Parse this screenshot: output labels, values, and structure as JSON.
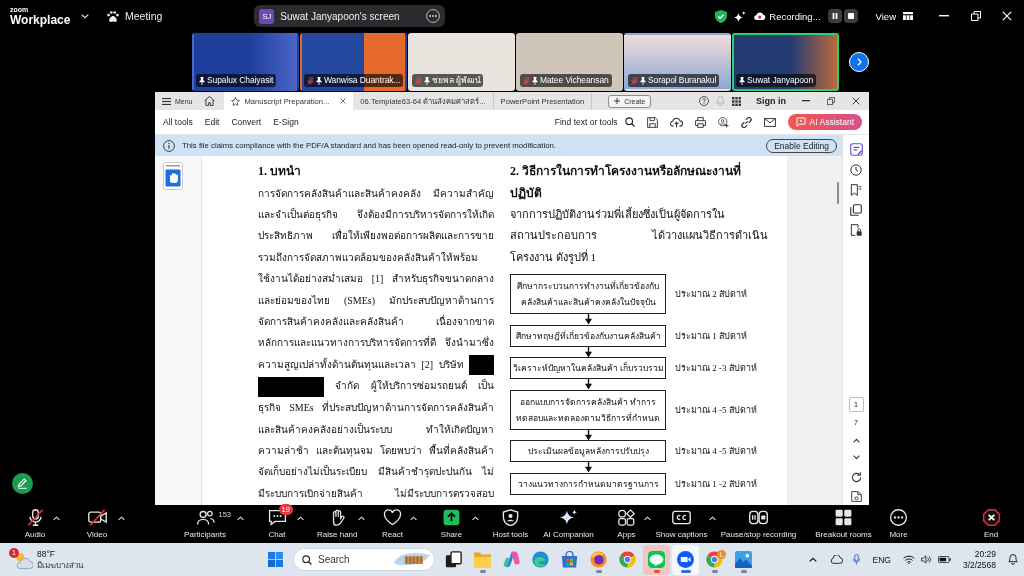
{
  "zoom_top_bar": {
    "logo": {
      "brand": "zoom",
      "product": "Workplace"
    },
    "meeting_label": "Meeting",
    "shared_screen": {
      "initials": "SJ",
      "title": "Suwat Janyapoon's screen"
    },
    "recording_label": "Recording...",
    "view_label": "View"
  },
  "video_strip": {
    "tiles": [
      {
        "name": "Supalux Chaiyasit",
        "muted": false,
        "speaking": false
      },
      {
        "name": "Wanwisa Duantrak...",
        "muted": true,
        "speaking": false
      },
      {
        "name": "ชยพล ผู้พัฒน์",
        "muted": true,
        "speaking": false
      },
      {
        "name": "Matee Vicheansan",
        "muted": true,
        "speaking": false
      },
      {
        "name": "Sorapol Buranakul",
        "muted": true,
        "speaking": false
      },
      {
        "name": "Suwat Janyapoon",
        "muted": false,
        "speaking": true
      }
    ]
  },
  "shared_window": {
    "tab_bar": {
      "menu_label": "Menu",
      "tabs": [
        {
          "label": "Manuscript Preparation...",
          "selected": true
        },
        {
          "label": "06.Template63-64 ด้านสังคมศาสตร์...",
          "selected": false
        },
        {
          "label": "PowerPoint Presentation",
          "selected": false
        }
      ],
      "create_label": "Create",
      "sign_in_label": "Sign in"
    },
    "toolbar": {
      "tools": [
        "All tools",
        "Edit",
        "Convert",
        "E-Sign"
      ],
      "find_label": "Find text or tools",
      "ai_label": "AI Assistant"
    },
    "banner": {
      "message": "This file claims compliance with the PDF/A standard and has been opened read-only to prevent modification.",
      "button_label": "Enable Editing"
    },
    "document": {
      "left_column": {
        "heading": "1. บทนำ",
        "lines": [
          {
            "kind": "text",
            "text": "การจัดการคลังสินค้าและสินค้าคงคลัง มีความสำคัญ"
          },
          {
            "kind": "text",
            "text": "และจำเป็นต่อธุรกิจ จึงต้องมีการบริหารจัดการให้เกิด"
          },
          {
            "kind": "text",
            "text": "ประสิทธิภาพ เพื่อให้เพียงพอต่อการผลิตและการขาย"
          },
          {
            "kind": "text",
            "text": "รวมถึงการจัดสภาพแวดล้อมของคลังสินค้าให้พร้อม"
          },
          {
            "kind": "text",
            "text": "ใช้งานได้อย่างสม่ำเสมอ [1] สำหรับธุรกิจขนาดกลาง"
          },
          {
            "kind": "text",
            "text": "และย่อมของไทย (SMEs) มักประสบปัญหาด้านการ"
          },
          {
            "kind": "text",
            "text": "จัดการสินค้าคงคลังและคลังสินค้า เนื่องจากขาด"
          },
          {
            "kind": "text",
            "text": "หลักการและแนวทางการบริหารจัดการที่ดี จึงนำมาซึ่ง"
          },
          {
            "kind": "redacted-end",
            "text": "ความสูญเปล่าทั้งด้านต้นทุนและเวลา [2] บริษัท"
          },
          {
            "kind": "redacted-start",
            "text": "จำกัด ผู้ให้บริการซ่อมรถยนต์ เป็น"
          },
          {
            "kind": "text",
            "text": "ธุรกิจ SMEs ที่ประสบปัญหาด้านการจัดการคลังสินค้า"
          },
          {
            "kind": "text",
            "text": "และสินค้าคงคลังอย่างเป็นระบบ ทำให้เกิดปัญหา"
          },
          {
            "kind": "text",
            "text": "ความล่าช้า และต้นทุนจม โดยพบว่า พื้นที่คลังสินค้า"
          },
          {
            "kind": "text",
            "text": "จัดเก็บอย่างไม่เป็นระเบียบ มีสินค้าชำรุดปะปนกัน ไม่"
          },
          {
            "kind": "text",
            "text": "มีระบบการเบิกจ่ายสินค้า ไม่มีระบบการตรวจสอบ"
          }
        ]
      },
      "right_column": {
        "heading_lines": [
          "2. วิธีการในการทำโครงงานหรือลักษณะงานที่",
          "ปฏิบัติ"
        ],
        "lines": [
          "จากการปฏิบัติงานร่วมพี่เลี้ยงซึ่งเป็นผู้จัดการใน",
          "สถานประกอบการ ได้วางแผนวิธีการดำเนิน",
          "โครงงาน ดังรูปที่ 1"
        ],
        "flowchart": [
          {
            "step": [
              "ศึกษากระบวนการทำงานที่เกี่ยวข้องกับ",
              "คลังสินค้าและสินค้าคงคลังในปัจจุบัน"
            ],
            "duration": "ประมาณ 2 สัปดาห์"
          },
          {
            "step": [
              "ศึกษาทฤษฎีที่เกี่ยวข้องกับงานคลังสินค้า"
            ],
            "duration": "ประมาณ 1 สัปดาห์"
          },
          {
            "step": [
              "วิเคราะห์ปัญหาในคลังสินค้า เก็บรวบรวม"
            ],
            "duration": "ประมาณ 2 -3 สัปดาห์"
          },
          {
            "step": [
              "ออกแบบการจัดการคลังสินค้า ทำการ",
              "ทดสอบและทดลองตามวิธีการที่กำหนด"
            ],
            "duration": "ประมาณ 4 -5 สัปดาห์"
          },
          {
            "step": [
              "ประเมินผลข้อมูลหลังการปรับปรุง"
            ],
            "duration": "ประมาณ 4 -5 สัปดาห์"
          },
          {
            "step": [
              "วางแนวทางการกำหนดมาตรฐานการ"
            ],
            "duration": "ประมาณ 1 -2 สัปดาห์"
          }
        ]
      }
    },
    "page_nav": {
      "current_page": "1",
      "total_pages": "7"
    }
  },
  "zoom_toolbar": {
    "controls": [
      {
        "kind": "audio",
        "label": "Audio",
        "off": true,
        "menu": true
      },
      {
        "kind": "video",
        "label": "Video",
        "off": true,
        "menu": true
      },
      {
        "kind": "participants",
        "label": "Participants",
        "count": "153",
        "off": false,
        "menu": true
      },
      {
        "kind": "chat",
        "label": "Chat",
        "badge": "19",
        "off": false,
        "menu": true
      },
      {
        "kind": "raise-hand",
        "label": "Raise hand",
        "off": false,
        "menu": true
      },
      {
        "kind": "react",
        "label": "React",
        "off": false,
        "menu": true
      },
      {
        "kind": "share",
        "label": "Share",
        "off": false,
        "menu": true
      },
      {
        "kind": "host-tools",
        "label": "Host tools",
        "off": false,
        "menu": false
      },
      {
        "kind": "ai-companion",
        "label": "AI Companion",
        "off": false,
        "menu": false
      },
      {
        "kind": "apps",
        "label": "Apps",
        "off": false,
        "menu": true
      },
      {
        "kind": "captions",
        "label": "Show captions",
        "off": false,
        "menu": true
      },
      {
        "kind": "recording",
        "label": "Pause/stop recording",
        "off": false,
        "menu": false
      },
      {
        "kind": "breakout",
        "label": "Breakout rooms",
        "off": false,
        "menu": false
      },
      {
        "kind": "more",
        "label": "More",
        "off": false,
        "menu": false
      },
      {
        "kind": "end",
        "label": "End",
        "off": false,
        "menu": false
      }
    ]
  },
  "taskbar": {
    "weather": {
      "badge": "1",
      "temperature": "88°F",
      "condition": "มีเมฆบางส่วน"
    },
    "search": {
      "placeholder": "Search"
    },
    "apps": [
      {
        "kind": "taskview",
        "running": false,
        "selected": false,
        "flashing": false
      },
      {
        "kind": "folder",
        "running": true,
        "selected": false,
        "flashing": false
      },
      {
        "kind": "copilot",
        "running": false,
        "selected": false,
        "flashing": false
      },
      {
        "kind": "edge",
        "running": false,
        "selected": false,
        "flashing": false
      },
      {
        "kind": "store",
        "running": false,
        "selected": false,
        "flashing": false
      },
      {
        "kind": "firefox",
        "running": true,
        "selected": false,
        "flashing": false
      },
      {
        "kind": "chrome",
        "running": false,
        "selected": false,
        "flashing": false
      },
      {
        "kind": "line",
        "running": true,
        "selected": false,
        "flashing": true
      },
      {
        "kind": "zoom",
        "running": true,
        "selected": true,
        "flashing": false
      },
      {
        "kind": "chrome",
        "running": true,
        "selected": false,
        "flashing": false,
        "badge": "L"
      },
      {
        "kind": "photos",
        "running": true,
        "selected": false,
        "flashing": false
      }
    ],
    "tray": {
      "language": "ENG",
      "time": "20:29",
      "date": "3/2/2568"
    }
  }
}
